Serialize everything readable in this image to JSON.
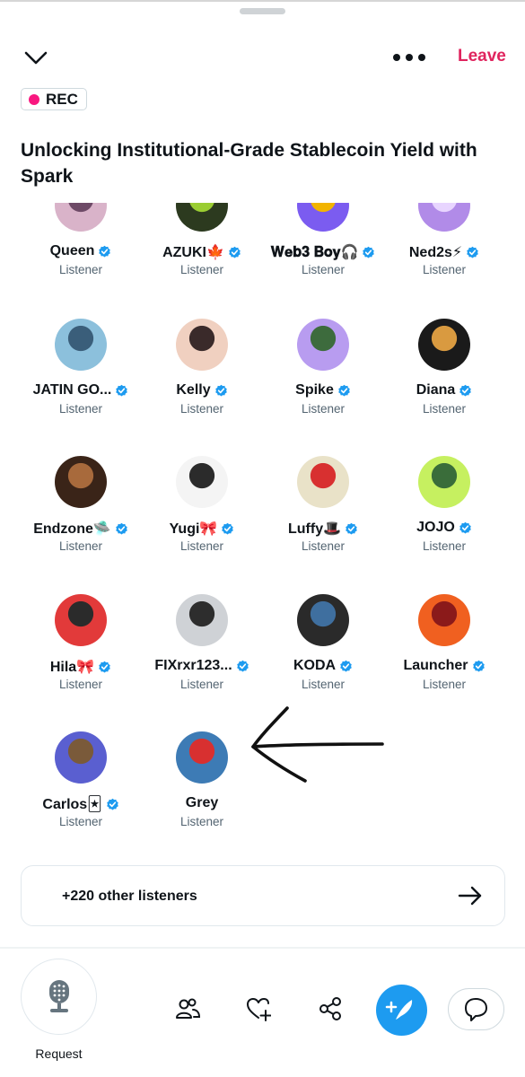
{
  "header": {
    "leave_label": "Leave"
  },
  "rec_label": "REC",
  "space_title": "Unlocking Institutional-Grade Stablecoin Yield with Spark",
  "listeners": [
    {
      "name": "Queen",
      "role": "Listener",
      "verified": true
    },
    {
      "name": "AZUKI🍁",
      "role": "Listener",
      "verified": true
    },
    {
      "name": "𝐖𝐞𝐛𝟑 𝐁𝐨𝐲🎧",
      "role": "Listener",
      "verified": true
    },
    {
      "name": "Ned2s⚡",
      "role": "Listener",
      "verified": true
    },
    {
      "name": "JATIN GO...",
      "role": "Listener",
      "verified": true
    },
    {
      "name": "Kelly",
      "role": "Listener",
      "verified": true
    },
    {
      "name": "Spike",
      "role": "Listener",
      "verified": true
    },
    {
      "name": "Diana",
      "role": "Listener",
      "verified": true
    },
    {
      "name": "Endzone🛸",
      "role": "Listener",
      "verified": true
    },
    {
      "name": "Yugi🎀",
      "role": "Listener",
      "verified": true
    },
    {
      "name": "Luffy🎩",
      "role": "Listener",
      "verified": true
    },
    {
      "name": "JOJO",
      "role": "Listener",
      "verified": true
    },
    {
      "name": "Hila🎀",
      "role": "Listener",
      "verified": true
    },
    {
      "name": "FIXrxr123...",
      "role": "Listener",
      "verified": true
    },
    {
      "name": "KODA",
      "role": "Listener",
      "verified": true
    },
    {
      "name": "Launcher",
      "role": "Listener",
      "verified": true
    },
    {
      "name": "Carlos🃏",
      "role": "Listener",
      "verified": true
    },
    {
      "name": "Grey",
      "role": "Listener",
      "verified": false
    }
  ],
  "other_listeners_label": "+220 other listeners",
  "bottom_bar": {
    "request_label": "Request",
    "icons": [
      "people-icon",
      "heart-plus-icon",
      "share-icon",
      "compose-icon",
      "chat-bubble-icon"
    ]
  },
  "colors": {
    "accent": "#1d9bf0",
    "leave": "#e0245e",
    "rec_dot": "#f91880"
  }
}
